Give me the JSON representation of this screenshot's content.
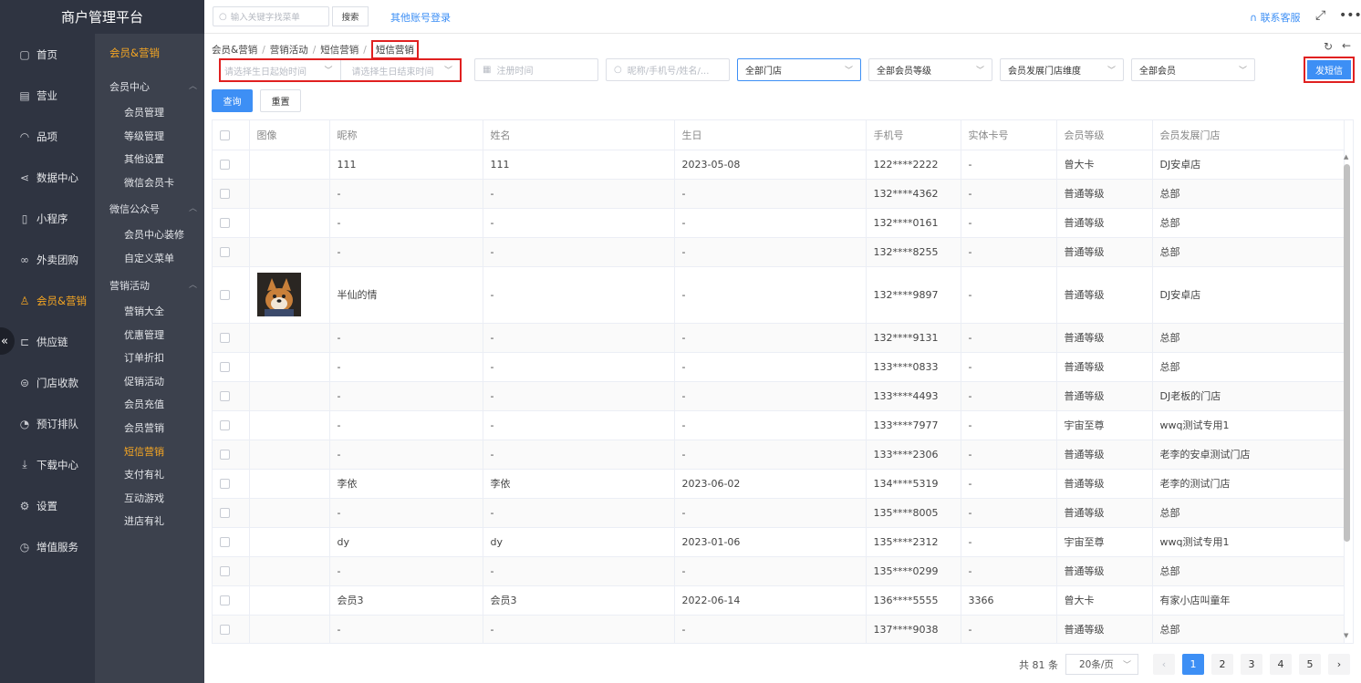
{
  "app": {
    "title": "商户管理平台"
  },
  "topbar": {
    "search_placeholder": "输入关键字找菜单",
    "search_btn": "搜索",
    "other_login": "其他账号登录",
    "service": "联系客服"
  },
  "nav1": [
    {
      "label": "首页",
      "icon": "▢"
    },
    {
      "label": "营业",
      "icon": "▤"
    },
    {
      "label": "品项",
      "icon": "◠"
    },
    {
      "label": "数据中心",
      "icon": "⋖"
    },
    {
      "label": "小程序",
      "icon": "▯"
    },
    {
      "label": "外卖团购",
      "icon": "∞"
    },
    {
      "label": "会员&营销",
      "icon": "♙"
    },
    {
      "label": "供应链",
      "icon": "⊏"
    },
    {
      "label": "门店收款",
      "icon": "⊜"
    },
    {
      "label": "预订排队",
      "icon": "◔"
    },
    {
      "label": "下载中心",
      "icon": "⤓"
    },
    {
      "label": "设置",
      "icon": "⚙"
    },
    {
      "label": "增值服务",
      "icon": "◷"
    }
  ],
  "nav2": {
    "title": "会员&营销",
    "group1": "会员中心",
    "group1_items": [
      "会员管理",
      "等级管理",
      "其他设置",
      "微信会员卡"
    ],
    "group2": "微信公众号",
    "group2_items": [
      "会员中心装修",
      "自定义菜单"
    ],
    "group3": "营销活动",
    "group3_items": [
      "营销大全",
      "优惠管理",
      "订单折扣",
      "促销活动",
      "会员充值",
      "会员营销",
      "短信营销",
      "支付有礼",
      "互动游戏",
      "进店有礼"
    ]
  },
  "breadcrumb": [
    "会员&营销",
    "营销活动",
    "短信营销",
    "短信营销"
  ],
  "filters": {
    "birth_start": "请选择生日起始时间",
    "birth_end": "请选择生日结束时间",
    "register_time": "注册时间",
    "keyword": "昵称/手机号/姓名/...",
    "store": "全部门店",
    "level": "全部会员等级",
    "dev_store_dim": "会员发展门店维度",
    "member_type": "全部会员",
    "send_sms": "发短信",
    "query": "查询",
    "reset": "重置"
  },
  "table": {
    "headers": [
      "图像",
      "昵称",
      "姓名",
      "生日",
      "手机号",
      "实体卡号",
      "会员等级",
      "会员发展门店"
    ],
    "rows": [
      {
        "nick": "111",
        "name": "111",
        "birthday": "2023-05-08",
        "phone": "122****2222",
        "card": "-",
        "level": "曾大卡",
        "store": "DJ安卓店"
      },
      {
        "nick": "-",
        "name": "-",
        "birthday": "-",
        "phone": "132****4362",
        "card": "-",
        "level": "普通等级",
        "store": "总部"
      },
      {
        "nick": "-",
        "name": "-",
        "birthday": "-",
        "phone": "132****0161",
        "card": "-",
        "level": "普通等级",
        "store": "总部"
      },
      {
        "nick": "-",
        "name": "-",
        "birthday": "-",
        "phone": "132****8255",
        "card": "-",
        "level": "普通等级",
        "store": "总部"
      },
      {
        "nick": "半仙的情",
        "name": "-",
        "birthday": "-",
        "phone": "132****9897",
        "card": "-",
        "level": "普通等级",
        "store": "DJ安卓店",
        "avatar": true
      },
      {
        "nick": "-",
        "name": "-",
        "birthday": "-",
        "phone": "132****9131",
        "card": "-",
        "level": "普通等级",
        "store": "总部"
      },
      {
        "nick": "-",
        "name": "-",
        "birthday": "-",
        "phone": "133****0833",
        "card": "-",
        "level": "普通等级",
        "store": "总部"
      },
      {
        "nick": "-",
        "name": "-",
        "birthday": "-",
        "phone": "133****4493",
        "card": "-",
        "level": "普通等级",
        "store": "DJ老板的门店"
      },
      {
        "nick": "-",
        "name": "-",
        "birthday": "-",
        "phone": "133****7977",
        "card": "-",
        "level": "宇宙至尊",
        "store": "wwq测试专用1"
      },
      {
        "nick": "-",
        "name": "-",
        "birthday": "-",
        "phone": "133****2306",
        "card": "-",
        "level": "普通等级",
        "store": "老李的安卓测试门店"
      },
      {
        "nick": "李依",
        "name": "李依",
        "birthday": "2023-06-02",
        "phone": "134****5319",
        "card": "-",
        "level": "普通等级",
        "store": "老李的测试门店"
      },
      {
        "nick": "-",
        "name": "-",
        "birthday": "-",
        "phone": "135****8005",
        "card": "-",
        "level": "普通等级",
        "store": "总部"
      },
      {
        "nick": "dy",
        "name": "dy",
        "birthday": "2023-01-06",
        "phone": "135****2312",
        "card": "-",
        "level": "宇宙至尊",
        "store": "wwq测试专用1"
      },
      {
        "nick": "-",
        "name": "-",
        "birthday": "-",
        "phone": "135****0299",
        "card": "-",
        "level": "普通等级",
        "store": "总部"
      },
      {
        "nick": "会员3",
        "name": "会员3",
        "birthday": "2022-06-14",
        "phone": "136****5555",
        "card": "3366",
        "level": "曾大卡",
        "store": "有家小店叫童年"
      },
      {
        "nick": "-",
        "name": "-",
        "birthday": "-",
        "phone": "137****9038",
        "card": "-",
        "level": "普通等级",
        "store": "总部"
      }
    ]
  },
  "pagination": {
    "total": "共 81 条",
    "page_size": "20条/页",
    "pages": [
      "1",
      "2",
      "3",
      "4",
      "5"
    ],
    "current": "1"
  },
  "colors": {
    "accent": "#3d8ff5",
    "active_nav": "#f5a623",
    "highlight_box": "#e02020"
  }
}
